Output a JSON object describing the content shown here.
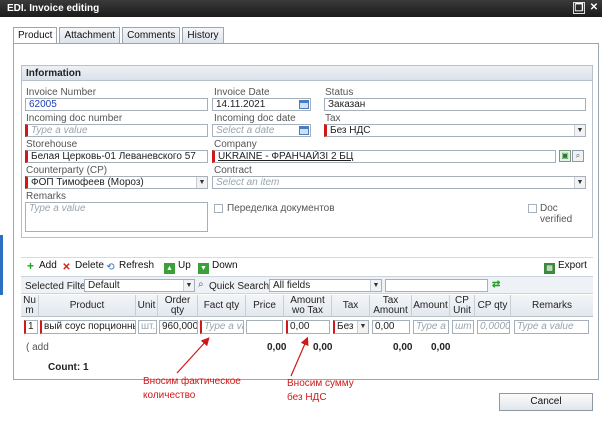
{
  "window": {
    "title": "EDI. Invoice editing"
  },
  "tabs": [
    "Product",
    "Attachment",
    "Comments",
    "History"
  ],
  "information": {
    "header": "Information",
    "invoice_number": {
      "label": "Invoice Number",
      "value": "62005"
    },
    "invoice_date": {
      "label": "Invoice Date",
      "value": "14.11.2021"
    },
    "status": {
      "label": "Status",
      "value": "Заказан"
    },
    "incoming_doc_number": {
      "label": "Incoming doc number",
      "placeholder": "Type a value"
    },
    "incoming_doc_date": {
      "label": "Incoming doc date",
      "placeholder": "Select a date"
    },
    "tax": {
      "label": "Tax",
      "value": "Без НДС"
    },
    "storehouse": {
      "label": "Storehouse",
      "value": "Белая Церковь-01 Леваневского 57"
    },
    "company": {
      "label": "Company",
      "value": "UKRAINE - ФРАНЧАЙЗІ 2 БЦ"
    },
    "counterparty": {
      "label": "Counterparty (CP)",
      "value": "ФОП Тимофеев (Мороз)"
    },
    "contract": {
      "label": "Contract",
      "placeholder": "Select an item"
    },
    "remarks": {
      "label": "Remarks",
      "placeholder": "Type a value"
    },
    "doc_rework": {
      "label": "Переделка документов"
    },
    "doc_verified": {
      "label": "Doc verified"
    }
  },
  "toolbar": {
    "add": "Add",
    "delete": "Delete",
    "refresh": "Refresh",
    "up": "Up",
    "down": "Down",
    "export": "Export"
  },
  "filter": {
    "selected_filter_label": "Selected Filter:",
    "selected_filter_value": "Default",
    "quick_search_label": "Quick Search:",
    "quick_search_value": "All fields"
  },
  "grid": {
    "columns": [
      "Nu m",
      "Product",
      "Unit",
      "Order qty",
      "Fact qty",
      "Price",
      "Amount wo Tax",
      "Tax",
      "Tax Amount",
      "Amount",
      "CP Unit",
      "CP qty",
      "Remarks"
    ],
    "edit_row": {
      "num": "1",
      "product": "вый соус порционный",
      "unit": "шт.",
      "order_qty": "960,0000",
      "fact_qty_placeholder": "Type a va",
      "price": "",
      "amount_wo_tax": "0,00",
      "tax": "Без Н",
      "tax_amount": "0,00",
      "amount_placeholder": "Type a",
      "cp_unit_placeholder": "шт",
      "cp_qty_placeholder": "0,0000",
      "remarks_placeholder": "Type a value"
    },
    "add_link": "( add",
    "totals": {
      "price": "0,00",
      "amount_wo_tax": "0,00",
      "tax_amount": "0,00",
      "amount": "0,00"
    },
    "count_label": "Count: 1"
  },
  "annotations": {
    "fact_qty_note": [
      "Вносим фактическое",
      "количество"
    ],
    "amount_note": [
      "Вносим сумму",
      "без НДС"
    ]
  },
  "buttons": {
    "cancel": "Cancel"
  },
  "colors": {
    "accent": "#d01818",
    "titlebar": "#222222"
  }
}
